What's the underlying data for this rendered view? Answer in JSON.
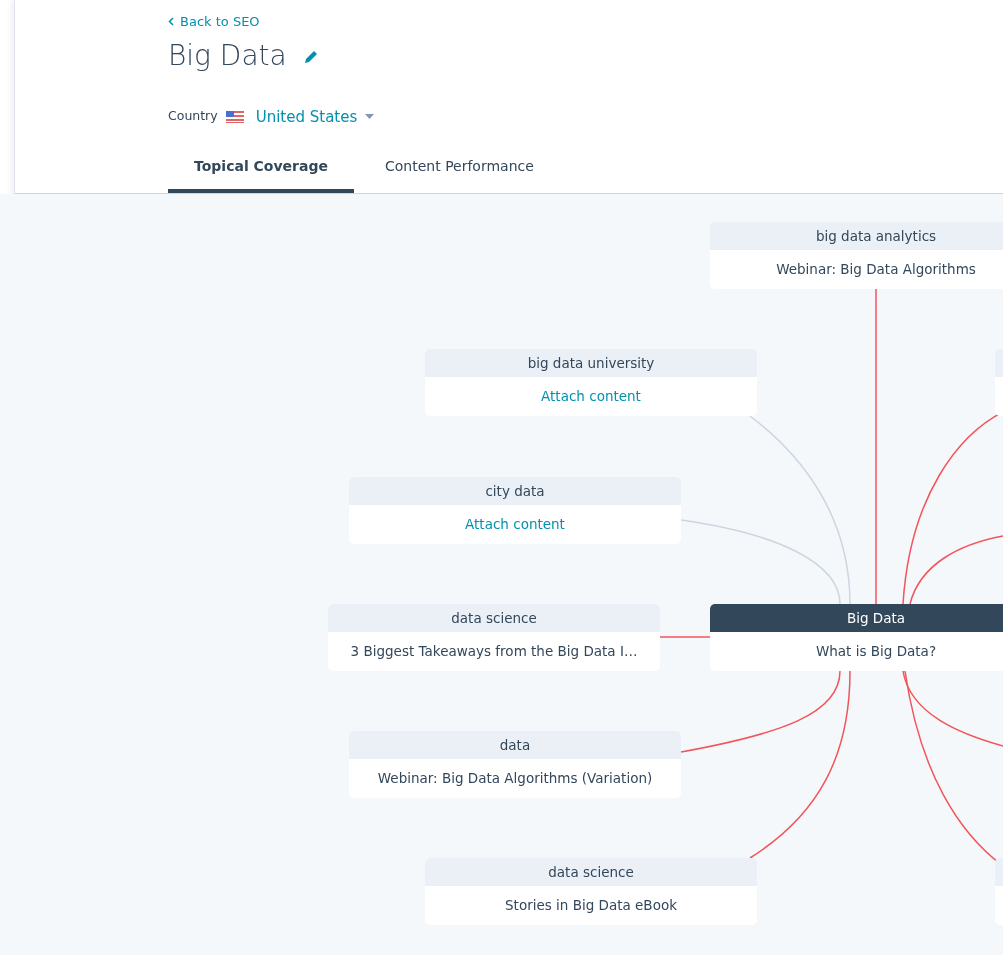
{
  "header": {
    "back_link": "Back to SEO",
    "title": "Big Data",
    "country_label": "Country",
    "country": "United States"
  },
  "tabs": [
    {
      "label": "Topical Coverage",
      "selected": true
    },
    {
      "label": "Content Performance",
      "selected": false
    }
  ],
  "map": {
    "nodes": [
      {
        "kind": "attached",
        "topic": "big data analytics",
        "content": "Webinar: Big Data Algorithms"
      },
      {
        "kind": "empty",
        "topic": "big data university",
        "content": "Attach content"
      },
      {
        "kind": "empty",
        "topic": "city data",
        "content": "Attach content"
      },
      {
        "kind": "attached",
        "topic": "data science",
        "content": "3 Biggest Takeaways from the Big Data I…"
      },
      {
        "kind": "center",
        "topic": "Big Data",
        "content": "What is Big Data?"
      },
      {
        "kind": "attached",
        "topic": "data",
        "content": "Webinar: Big Data Algorithms (Variation)"
      },
      {
        "kind": "attached",
        "topic": "data science",
        "content": "Stories in Big Data eBook"
      },
      {
        "kind": "clipped"
      },
      {
        "kind": "clipped"
      }
    ]
  }
}
